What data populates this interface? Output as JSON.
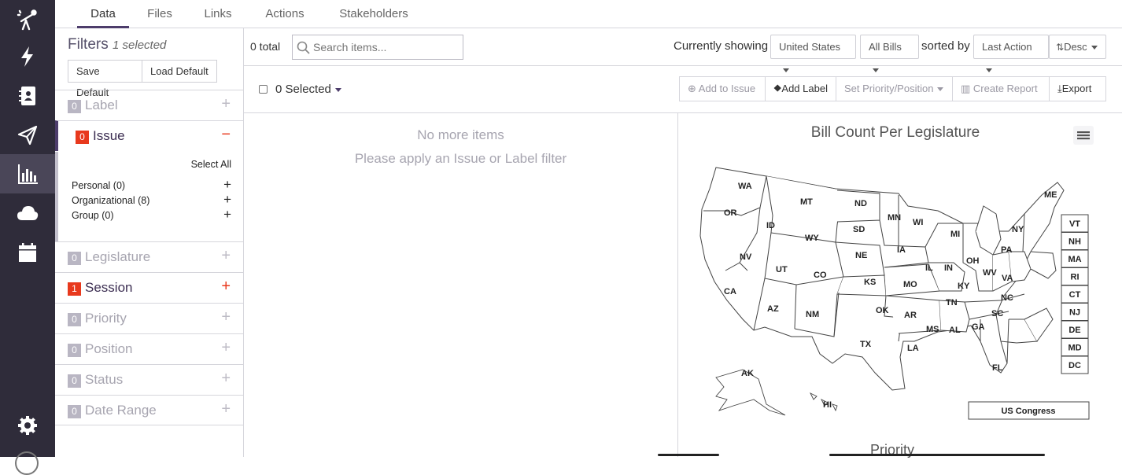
{
  "rail": {
    "icons": [
      "telescope-icon",
      "lightning-icon",
      "contacts-icon",
      "send-icon",
      "analytics-icon",
      "cloud-icon",
      "calendar-icon",
      "settings-icon"
    ],
    "active": "analytics-icon",
    "bg_color": "#2f2c3a"
  },
  "tabs": [
    {
      "label": "Data",
      "active": true
    },
    {
      "label": "Files",
      "active": false
    },
    {
      "label": "Links",
      "active": false
    },
    {
      "label": "Actions",
      "active": false
    },
    {
      "label": "Stakeholders",
      "active": false
    }
  ],
  "filters": {
    "title": "Filters",
    "selected_text": "1 selected",
    "save_default": "Save Default",
    "load_default": "Load Default",
    "groups": [
      {
        "count": "0",
        "label": "Label",
        "toggle": "+"
      },
      {
        "count": "0",
        "label": "Issue",
        "toggle": "−"
      },
      {
        "count": "0",
        "label": "Legislature",
        "toggle": "+"
      },
      {
        "count": "1",
        "label": "Session",
        "toggle": "+"
      },
      {
        "count": "0",
        "label": "Priority",
        "toggle": "+"
      },
      {
        "count": "0",
        "label": "Position",
        "toggle": "+"
      },
      {
        "count": "0",
        "label": "Status",
        "toggle": "+"
      },
      {
        "count": "0",
        "label": "Date Range",
        "toggle": "+"
      }
    ],
    "issue": {
      "select_all": "Select All",
      "items": [
        {
          "label": "Personal (0)",
          "toggle": "+"
        },
        {
          "label": "Organizational (8)",
          "toggle": "+"
        },
        {
          "label": "Group (0)",
          "toggle": "+"
        }
      ]
    }
  },
  "toolbar": {
    "total": "0 total",
    "search_placeholder": "Search items...",
    "currently_showing": "Currently showing",
    "country": "United States",
    "bills": "All Bills",
    "sorted_by": "sorted by",
    "sort_field": "Last Action",
    "sort_dir": "Desc"
  },
  "actions": {
    "selected": "0 Selected",
    "add_to_issue": "Add to Issue",
    "add_label": "Add Label",
    "set_priority": "Set Priority/Position",
    "create_report": "Create Report",
    "export": "Export"
  },
  "list": {
    "empty_title": "No more items",
    "empty_hint": "Please apply an Issue or Label filter"
  },
  "map": {
    "title": "Bill Count Per Legislature",
    "states": [
      "WA",
      "OR",
      "CA",
      "ID",
      "NV",
      "MT",
      "WY",
      "UT",
      "AZ",
      "CO",
      "NM",
      "ND",
      "SD",
      "NE",
      "KS",
      "OK",
      "TX",
      "MN",
      "IA",
      "MO",
      "AR",
      "LA",
      "WI",
      "IL",
      "MS",
      "MI",
      "IN",
      "KY",
      "TN",
      "AL",
      "OH",
      "WV",
      "VA",
      "NC",
      "SC",
      "GA",
      "FL",
      "PA",
      "NY",
      "ME",
      "AK",
      "HI"
    ],
    "ne_states": [
      "VT",
      "NH",
      "MA",
      "RI",
      "CT",
      "NJ",
      "DE",
      "MD",
      "DC"
    ],
    "congress": "US Congress",
    "next_chart_title": "Priority"
  },
  "colors": {
    "accent": "#4d3d6b",
    "badge_red": "#e8391d",
    "badge_gray": "#b9b6c3"
  }
}
